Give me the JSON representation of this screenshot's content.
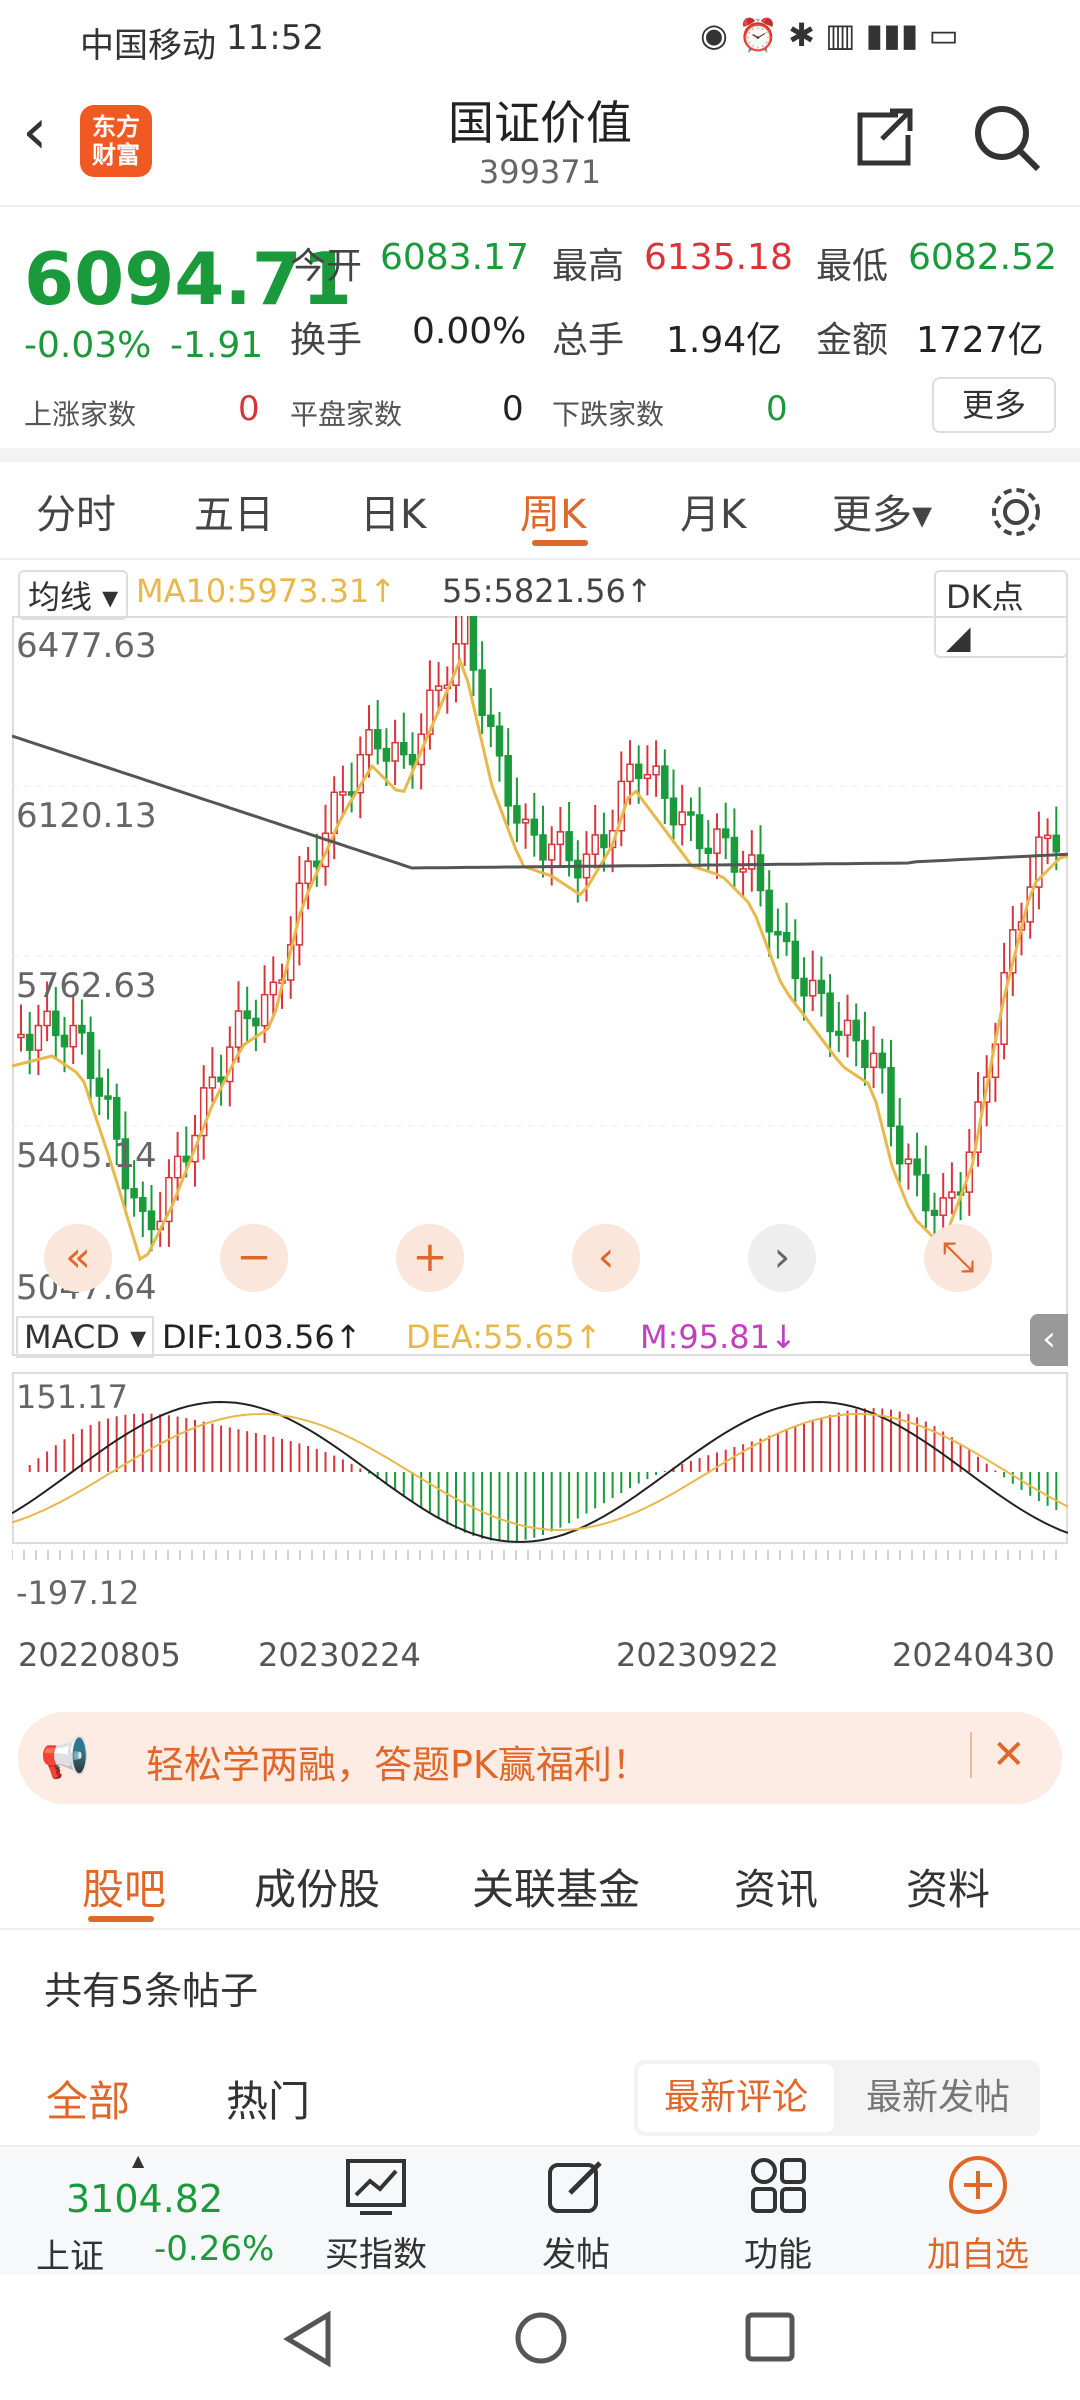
{
  "status": {
    "carrier": "中国移动",
    "time": "11:52"
  },
  "header": {
    "title": "国证价值",
    "code": "399371",
    "logo_line1": "东方",
    "logo_line2": "财富"
  },
  "quote": {
    "price": "6094.71",
    "change_pct": "-0.03%",
    "change": "-1.91",
    "open_label": "今开",
    "open": "6083.17",
    "high_label": "最高",
    "high": "6135.18",
    "low_label": "最低",
    "low": "6082.52",
    "turnover_label": "换手",
    "turnover": "0.00%",
    "volume_label": "总手",
    "volume": "1.94亿",
    "amount_label": "金额",
    "amount": "1727亿",
    "up_label": "上涨家数",
    "up": "0",
    "flat_label": "平盘家数",
    "flat": "0",
    "down_label": "下跌家数",
    "down": "0",
    "more": "更多"
  },
  "tabs": [
    "分时",
    "五日",
    "日K",
    "周K",
    "月K",
    "更多▾"
  ],
  "active_tab": "周K",
  "chart_legend": {
    "indicator": "均线 ▾",
    "ma10": "MA10:5973.31↑",
    "ma55": "55:5821.56↑",
    "dk": "DK点 ◢"
  },
  "chart_data": {
    "type": "candlestick",
    "y_ticks": [
      "6477.63",
      "6120.13",
      "5762.63",
      "5405.14",
      "5047.64"
    ],
    "x_ticks": [
      "20220805",
      "20230224",
      "20230922",
      "20240430"
    ],
    "ylim": [
      5047.64,
      6477.63
    ]
  },
  "macd": {
    "label": "MACD ▾",
    "dif": "DIF:103.56↑",
    "dea": "DEA:55.65↑",
    "m": "M:95.81↓",
    "top": "151.17",
    "bottom": "-197.12"
  },
  "controls": [
    "«",
    "−",
    "+",
    "‹",
    "›",
    "⤡"
  ],
  "banner": {
    "text": "轻松学两融，答题PK赢福利！",
    "close": "✕"
  },
  "bottom_tabs": [
    "股吧",
    "成份股",
    "关联基金",
    "资讯",
    "资料"
  ],
  "posts": {
    "count": "共有5条帖子",
    "filter_all": "全部",
    "filter_hot": "热门",
    "sort_latest_comment": "最新评论",
    "sort_latest_post": "最新发帖"
  },
  "navbar": {
    "index_price": "3104.82",
    "index_name": "上证",
    "index_change": "-0.26%",
    "buy": "买指数",
    "post": "发帖",
    "func": "功能",
    "add": "加自选"
  },
  "colors": {
    "up": "#d8343a",
    "down": "#1a9a3a",
    "accent": "#e0672a",
    "ma10": "#e8b84a",
    "ma55": "#555555"
  }
}
